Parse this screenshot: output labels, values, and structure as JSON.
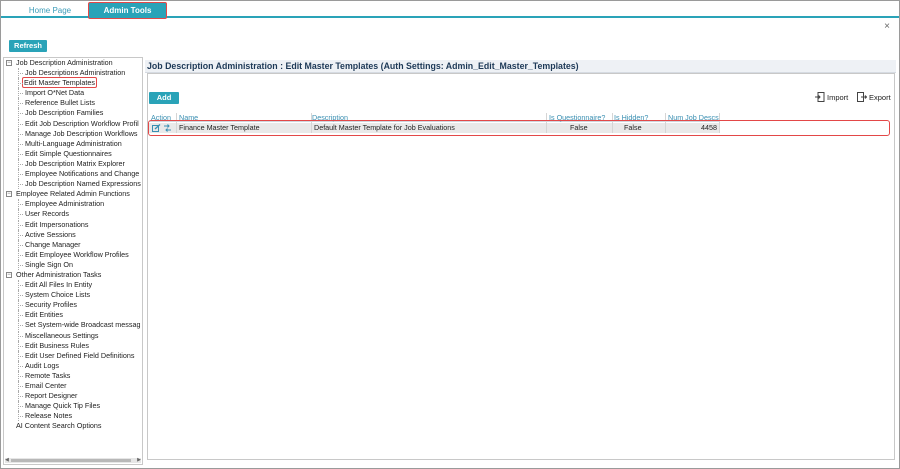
{
  "tabs": {
    "home": "Home Page",
    "admin": "Admin Tools"
  },
  "toolbar": {
    "refresh": "Refresh",
    "close": "×"
  },
  "tree": {
    "groups": [
      {
        "label": "Job Description Administration",
        "toggle": "−",
        "items": [
          "Job Descriptions Administration",
          "Edit Master Templates",
          "Import O*Net Data",
          "Reference Bullet Lists",
          "Job Description Families",
          "Edit Job Description Workflow Profil",
          "Manage Job Description Workflows",
          "Multi-Language Administration",
          "Edit Simple Questionnaires",
          "Job Description Matrix Explorer",
          "Employee Notifications and Change",
          "Job Description Named Expressions"
        ]
      },
      {
        "label": "Employee Related Admin Functions",
        "toggle": "−",
        "items": [
          "Employee Administration",
          "User Records",
          "Edit Impersonations",
          "Active Sessions",
          "Change Manager",
          "Edit Employee Workflow Profiles",
          "Single Sign On"
        ]
      },
      {
        "label": "Other Administration Tasks",
        "toggle": "−",
        "items": [
          "Edit All Files In Entity",
          "System Choice Lists",
          "Security Profiles",
          "Edit Entities",
          "Set System-wide Broadcast messag",
          "Miscellaneous Settings",
          "Edit Business Rules",
          "Edit User Defined Field Definitions",
          "Audit Logs",
          "Remote Tasks",
          "Email Center",
          "Report Designer",
          "Manage Quick Tip Files",
          "Release Notes"
        ]
      }
    ],
    "extra": "AI Content Search Options",
    "selected": "Edit Master Templates"
  },
  "panel": {
    "title": "Job Description Administration : Edit Master Templates (Auth Settings: Admin_Edit_Master_Templates)",
    "add": "Add",
    "import": "Import",
    "export": "Export"
  },
  "grid": {
    "columns": {
      "action": "Action",
      "name": "Name",
      "description": "Description",
      "questionnaire": "Is Questionnaire?",
      "hidden": "Is Hidden?",
      "num": "Num Job Descs"
    },
    "rows": [
      {
        "name": "Finance Master Template",
        "description": "Default Master Template for Job Evaluations",
        "questionnaire": "False",
        "hidden": "False",
        "num": "4458"
      }
    ]
  },
  "colors": {
    "accent": "#2aa3b8",
    "highlight": "#e34848",
    "title": "#1d3957"
  }
}
